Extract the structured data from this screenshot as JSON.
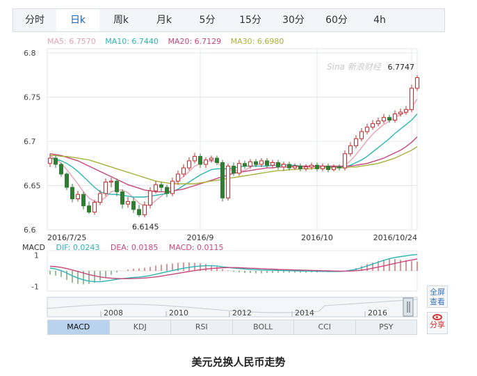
{
  "tabs": [
    "分时",
    "日k",
    "周k",
    "月k",
    "5分",
    "15分",
    "30分",
    "60分",
    "4h"
  ],
  "active_tab": 1,
  "ma_legend": [
    {
      "label": "MA5: 6.7570",
      "color": "#e8a0b4"
    },
    {
      "label": "MA10: 6.7440",
      "color": "#29b5b5"
    },
    {
      "label": "MA20: 6.7129",
      "color": "#c8467c"
    },
    {
      "label": "MA30: 6.6980",
      "color": "#a7b23a"
    }
  ],
  "macd_legend": {
    "name": "MACD",
    "dif": {
      "label": "DIF: 0.0243",
      "color": "#29b5b5"
    },
    "dea": {
      "label": "DEA: 0.0185",
      "color": "#c8467c"
    },
    "macd": {
      "label": "MACD: 0.0115",
      "color": "#c8467c"
    }
  },
  "watermark": "Sina 新浪财经",
  "side_buttons": {
    "fullscreen": "全屏\n查看",
    "share": "分享"
  },
  "indicators": [
    "MACD",
    "KDJ",
    "RSI",
    "BOLL",
    "CCI",
    "PSY"
  ],
  "active_indicator": 0,
  "caption": "美元兑换人民币走势",
  "colors": {
    "up": "#c62828",
    "down": "#2e7d32",
    "grid": "#e3e7ec"
  },
  "chart_data": {
    "type": "candlestick",
    "title": "",
    "ylim": [
      6.6,
      6.8
    ],
    "yticks": [
      "6.8",
      "6.75",
      "6.7",
      "6.65",
      "6.6"
    ],
    "ytick_values": [
      6.8,
      6.75,
      6.7,
      6.65,
      6.6
    ],
    "xtick_labels": [
      {
        "label": "2016/7/25",
        "index": 0
      },
      {
        "label": "2016/9",
        "index": 27
      },
      {
        "label": "2016/10",
        "index": 48
      },
      {
        "label": "2016/10/24",
        "index": 65
      }
    ],
    "annotations": [
      {
        "label": "6.7747",
        "index": 66,
        "value": 6.7747
      },
      {
        "label": "6.6145",
        "index": 16,
        "value": 6.6145
      }
    ],
    "candles": [
      [
        6.675,
        6.681,
        6.686,
        6.671
      ],
      [
        6.681,
        6.674,
        6.684,
        6.67
      ],
      [
        6.674,
        6.663,
        6.676,
        6.66
      ],
      [
        6.663,
        6.648,
        6.665,
        6.645
      ],
      [
        6.648,
        6.635,
        6.652,
        6.631
      ],
      [
        6.635,
        6.64,
        6.644,
        6.632
      ],
      [
        6.64,
        6.627,
        6.643,
        6.623
      ],
      [
        6.627,
        6.62,
        6.632,
        6.618
      ],
      [
        6.62,
        6.631,
        6.634,
        6.617
      ],
      [
        6.631,
        6.641,
        6.645,
        6.628
      ],
      [
        6.641,
        6.654,
        6.658,
        6.638
      ],
      [
        6.654,
        6.655,
        6.659,
        6.648
      ],
      [
        6.655,
        6.643,
        6.658,
        6.638
      ],
      [
        6.643,
        6.629,
        6.646,
        6.624
      ],
      [
        6.629,
        6.632,
        6.637,
        6.625
      ],
      [
        6.632,
        6.623,
        6.636,
        6.619
      ],
      [
        6.623,
        6.617,
        6.628,
        6.6145
      ],
      [
        6.617,
        6.628,
        6.632,
        6.614
      ],
      [
        6.628,
        6.644,
        6.648,
        6.624
      ],
      [
        6.644,
        6.651,
        6.655,
        6.641
      ],
      [
        6.651,
        6.648,
        6.654,
        6.643
      ],
      [
        6.648,
        6.641,
        6.651,
        6.637
      ],
      [
        6.641,
        6.655,
        6.659,
        6.638
      ],
      [
        6.655,
        6.663,
        6.667,
        6.651
      ],
      [
        6.663,
        6.67,
        6.674,
        6.66
      ],
      [
        6.67,
        6.678,
        6.682,
        6.667
      ],
      [
        6.678,
        6.683,
        6.687,
        6.675
      ],
      [
        6.683,
        6.674,
        6.686,
        6.67
      ],
      [
        6.674,
        6.679,
        6.682,
        6.67
      ],
      [
        6.679,
        6.681,
        6.684,
        6.676
      ],
      [
        6.681,
        6.676,
        6.684,
        6.673
      ],
      [
        6.676,
        6.636,
        6.679,
        6.632
      ],
      [
        6.636,
        6.672,
        6.675,
        6.633
      ],
      [
        6.672,
        6.664,
        6.676,
        6.661
      ],
      [
        6.664,
        6.675,
        6.679,
        6.661
      ],
      [
        6.675,
        6.672,
        6.678,
        6.669
      ],
      [
        6.672,
        6.677,
        6.68,
        6.669
      ],
      [
        6.677,
        6.674,
        6.68,
        6.671
      ],
      [
        6.674,
        6.678,
        6.681,
        6.671
      ],
      [
        6.678,
        6.673,
        6.681,
        6.67
      ],
      [
        6.673,
        6.676,
        6.679,
        6.67
      ],
      [
        6.676,
        6.671,
        6.679,
        6.668
      ],
      [
        6.671,
        6.674,
        6.677,
        6.667
      ],
      [
        6.674,
        6.67,
        6.677,
        6.667
      ],
      [
        6.67,
        6.672,
        6.675,
        6.668
      ],
      [
        6.672,
        6.669,
        6.675,
        6.666
      ],
      [
        6.669,
        6.671,
        6.674,
        6.666
      ],
      [
        6.671,
        6.673,
        6.676,
        6.668
      ],
      [
        6.673,
        6.669,
        6.676,
        6.666
      ],
      [
        6.669,
        6.672,
        6.675,
        6.666
      ],
      [
        6.672,
        6.668,
        6.675,
        6.665
      ],
      [
        6.668,
        6.671,
        6.674,
        6.666
      ],
      [
        6.671,
        6.67,
        6.674,
        6.667
      ],
      [
        6.67,
        6.686,
        6.69,
        6.667
      ],
      [
        6.686,
        6.695,
        6.699,
        6.683
      ],
      [
        6.695,
        6.703,
        6.707,
        6.692
      ],
      [
        6.703,
        6.711,
        6.715,
        6.7
      ],
      [
        6.711,
        6.716,
        6.72,
        6.708
      ],
      [
        6.716,
        6.72,
        6.724,
        6.713
      ],
      [
        6.72,
        6.723,
        6.727,
        6.717
      ],
      [
        6.723,
        6.727,
        6.731,
        6.72
      ],
      [
        6.727,
        6.724,
        6.73,
        6.721
      ],
      [
        6.724,
        6.731,
        6.735,
        6.721
      ],
      [
        6.731,
        6.733,
        6.737,
        6.728
      ],
      [
        6.733,
        6.736,
        6.74,
        6.73
      ],
      [
        6.736,
        6.76,
        6.764,
        6.733
      ],
      [
        6.76,
        6.772,
        6.7747,
        6.757
      ]
    ],
    "ma": [
      {
        "name": "MA5",
        "color": "#e8a0b4",
        "values": [
          6.684,
          6.68,
          6.675,
          6.668,
          6.66,
          6.652,
          6.643,
          6.636,
          6.632,
          6.632,
          6.637,
          6.643,
          6.645,
          6.645,
          6.642,
          6.636,
          6.63,
          6.627,
          6.628,
          6.633,
          6.638,
          6.644,
          6.65,
          6.656,
          6.66,
          6.666,
          6.672,
          6.675,
          6.677,
          6.678,
          6.677,
          6.67,
          6.668,
          6.667,
          6.667,
          6.667,
          6.671,
          6.673,
          6.675,
          6.676,
          6.676,
          6.675,
          6.674,
          6.673,
          6.672,
          6.671,
          6.671,
          6.671,
          6.671,
          6.671,
          6.671,
          6.67,
          6.67,
          6.673,
          6.678,
          6.685,
          6.693,
          6.701,
          6.708,
          6.714,
          6.719,
          6.723,
          6.727,
          6.73,
          6.733,
          6.738,
          6.748
        ]
      },
      {
        "name": "MA10",
        "color": "#29b5b5",
        "values": [
          6.681,
          6.68,
          6.678,
          6.675,
          6.671,
          6.666,
          6.66,
          6.654,
          6.648,
          6.643,
          6.641,
          6.64,
          6.64,
          6.639,
          6.638,
          6.637,
          6.637,
          6.637,
          6.638,
          6.639,
          6.64,
          6.641,
          6.643,
          6.646,
          6.65,
          6.654,
          6.658,
          6.662,
          6.665,
          6.668,
          6.669,
          6.669,
          6.669,
          6.67,
          6.671,
          6.672,
          6.672,
          6.672,
          6.672,
          6.672,
          6.673,
          6.673,
          6.673,
          6.673,
          6.673,
          6.672,
          6.672,
          6.672,
          6.672,
          6.672,
          6.671,
          6.671,
          6.671,
          6.671,
          6.673,
          6.676,
          6.679,
          6.683,
          6.688,
          6.693,
          6.698,
          6.703,
          6.709,
          6.714,
          6.719,
          6.724,
          6.731
        ]
      },
      {
        "name": "MA20",
        "color": "#c8467c",
        "values": [
          6.686,
          6.685,
          6.684,
          6.682,
          6.68,
          6.678,
          6.675,
          6.672,
          6.669,
          6.666,
          6.663,
          6.66,
          6.657,
          6.654,
          6.651,
          6.649,
          6.647,
          6.645,
          6.644,
          6.643,
          6.643,
          6.643,
          6.644,
          6.645,
          6.646,
          6.648,
          6.65,
          6.652,
          6.654,
          6.656,
          6.658,
          6.66,
          6.662,
          6.664,
          6.665,
          6.666,
          6.667,
          6.668,
          6.669,
          6.67,
          6.67,
          6.671,
          6.671,
          6.671,
          6.672,
          6.672,
          6.672,
          6.672,
          6.672,
          6.672,
          6.672,
          6.672,
          6.672,
          6.672,
          6.672,
          6.673,
          6.674,
          6.675,
          6.677,
          6.679,
          6.681,
          6.684,
          6.687,
          6.69,
          6.694,
          6.699,
          6.705
        ]
      },
      {
        "name": "MA30",
        "color": "#a7b23a",
        "values": [
          6.684,
          6.684,
          6.683,
          6.683,
          6.682,
          6.681,
          6.68,
          6.679,
          6.677,
          6.675,
          6.673,
          6.671,
          6.669,
          6.667,
          6.665,
          6.663,
          6.661,
          6.659,
          6.657,
          6.655,
          6.654,
          6.653,
          6.652,
          6.652,
          6.652,
          6.652,
          6.652,
          6.653,
          6.654,
          6.655,
          6.656,
          6.657,
          6.658,
          6.659,
          6.66,
          6.661,
          6.662,
          6.663,
          6.664,
          6.665,
          6.666,
          6.667,
          6.667,
          6.668,
          6.668,
          6.669,
          6.669,
          6.669,
          6.67,
          6.67,
          6.67,
          6.67,
          6.67,
          6.67,
          6.671,
          6.671,
          6.672,
          6.673,
          6.674,
          6.675,
          6.677,
          6.679,
          6.681,
          6.684,
          6.687,
          6.69,
          6.694
        ]
      }
    ],
    "macd": {
      "ylim": [
        -1.3,
        1.3
      ],
      "yticks": [
        "1",
        "-1"
      ],
      "ytick_values": [
        1,
        -1
      ],
      "dif": [
        0.18,
        0.12,
        0.02,
        -0.14,
        -0.32,
        -0.46,
        -0.58,
        -0.66,
        -0.7,
        -0.7,
        -0.66,
        -0.6,
        -0.54,
        -0.5,
        -0.46,
        -0.42,
        -0.4,
        -0.36,
        -0.3,
        -0.22,
        -0.14,
        -0.06,
        0.02,
        0.1,
        0.17,
        0.23,
        0.28,
        0.31,
        0.33,
        0.33,
        0.31,
        0.26,
        0.22,
        0.18,
        0.15,
        0.12,
        0.1,
        0.08,
        0.06,
        0.05,
        0.04,
        0.03,
        0.02,
        0.01,
        0.0,
        -0.01,
        -0.02,
        -0.02,
        -0.03,
        -0.03,
        -0.04,
        -0.04,
        -0.04,
        -0.02,
        0.03,
        0.1,
        0.2,
        0.32,
        0.44,
        0.56,
        0.68,
        0.78,
        0.86,
        0.92,
        0.97,
        1.02,
        1.06
      ],
      "dea": [
        0.3,
        0.27,
        0.22,
        0.15,
        0.06,
        -0.04,
        -0.14,
        -0.24,
        -0.32,
        -0.39,
        -0.44,
        -0.47,
        -0.49,
        -0.5,
        -0.5,
        -0.49,
        -0.48,
        -0.46,
        -0.43,
        -0.39,
        -0.34,
        -0.28,
        -0.22,
        -0.16,
        -0.1,
        -0.04,
        0.02,
        0.07,
        0.11,
        0.15,
        0.18,
        0.2,
        0.21,
        0.21,
        0.2,
        0.19,
        0.17,
        0.16,
        0.14,
        0.12,
        0.11,
        0.09,
        0.08,
        0.07,
        0.06,
        0.05,
        0.04,
        0.03,
        0.02,
        0.01,
        0.0,
        -0.01,
        -0.02,
        -0.02,
        -0.01,
        0.01,
        0.05,
        0.1,
        0.17,
        0.24,
        0.32,
        0.4,
        0.48,
        0.56,
        0.63,
        0.7,
        0.76
      ],
      "hist": [
        -0.24,
        -0.3,
        -0.4,
        -0.58,
        -0.76,
        -0.84,
        -0.88,
        -0.84,
        -0.76,
        -0.62,
        -0.44,
        -0.26,
        -0.1,
        0.0,
        0.08,
        0.14,
        0.16,
        0.2,
        0.26,
        0.34,
        0.4,
        0.44,
        0.48,
        0.52,
        0.54,
        0.54,
        0.52,
        0.48,
        0.44,
        0.36,
        0.26,
        0.12,
        0.02,
        -0.06,
        -0.1,
        -0.14,
        -0.14,
        -0.16,
        -0.16,
        -0.14,
        -0.14,
        -0.12,
        -0.12,
        -0.12,
        -0.12,
        -0.12,
        -0.12,
        -0.1,
        -0.1,
        -0.08,
        -0.08,
        -0.06,
        -0.04,
        0.0,
        0.08,
        0.18,
        0.3,
        0.44,
        0.54,
        0.64,
        0.72,
        0.76,
        0.76,
        0.72,
        0.68,
        0.64,
        0.6
      ]
    },
    "overview_ticks": [
      "2008",
      "2010",
      "2012",
      "2014",
      "2016"
    ]
  }
}
